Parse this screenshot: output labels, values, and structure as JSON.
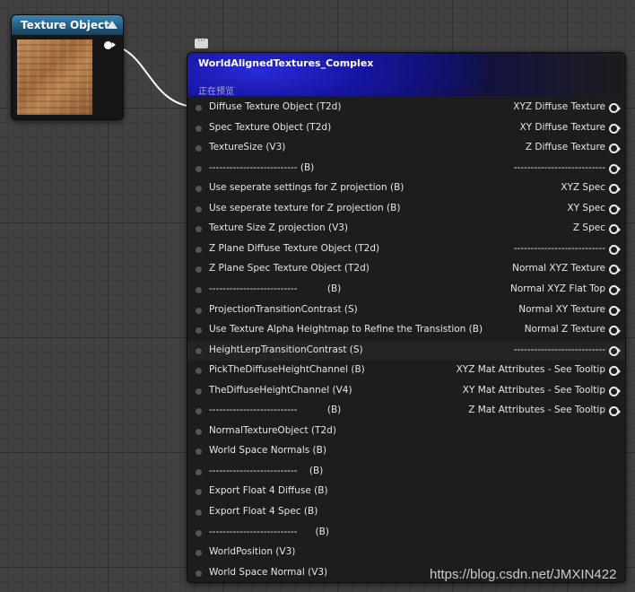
{
  "texture_node": {
    "title": "Texture Object"
  },
  "main_node": {
    "title": "WorldAlignedTextures_Complex",
    "subtitle": "正在预览",
    "rows": [
      {
        "in": "Diffuse Texture Object (T2d)",
        "out": "XYZ Diffuse Texture"
      },
      {
        "in": "Spec Texture Object (T2d)",
        "out": "XY Diffuse Texture"
      },
      {
        "in": "TextureSize (V3)",
        "out": "Z Diffuse Texture"
      },
      {
        "in": "-------------------------- (B)",
        "out": "---------------------------"
      },
      {
        "in": "Use seperate settings for Z projection (B)",
        "out": "XYZ Spec"
      },
      {
        "in": "Use seperate texture for Z projection (B)",
        "out": "XY Spec"
      },
      {
        "in": "Texture Size Z projection (V3)",
        "out": "Z Spec"
      },
      {
        "in": "Z Plane Diffuse Texture Object (T2d)",
        "out": "---------------------------"
      },
      {
        "in": "Z Plane Spec Texture Object (T2d)",
        "out": "Normal XYZ Texture"
      },
      {
        "in": "--------------------------          (B)",
        "out": "Normal XYZ Flat Top"
      },
      {
        "in": "ProjectionTransitionContrast (S)",
        "out": "Normal XY Texture"
      },
      {
        "in": "Use Texture Alpha Heightmap to Refine the Transistion (B)",
        "out": "Normal Z Texture"
      },
      {
        "in": "HeightLerpTransitionContrast (S)",
        "out": "---------------------------"
      },
      {
        "in": "PickTheDiffuseHeightChannel (B)",
        "out": "XYZ Mat Attributes - See Tooltip"
      },
      {
        "in": "TheDiffuseHeightChannel (V4)",
        "out": "XY Mat Attributes - See Tooltip"
      },
      {
        "in": "--------------------------          (B)",
        "out": "Z Mat Attributes - See Tooltip"
      },
      {
        "in": "NormalTextureObject (T2d)",
        "out": ""
      },
      {
        "in": "World Space Normals (B)",
        "out": ""
      },
      {
        "in": "--------------------------    (B)",
        "out": ""
      },
      {
        "in": "Export Float 4 Diffuse (B)",
        "out": ""
      },
      {
        "in": "Export Float 4 Spec (B)",
        "out": ""
      },
      {
        "in": "--------------------------      (B)",
        "out": ""
      },
      {
        "in": "WorldPosition (V3)",
        "out": ""
      },
      {
        "in": "World Space Normal (V3)",
        "out": ""
      }
    ]
  },
  "watermark": "https://blog.csdn.net/JMXIN422"
}
